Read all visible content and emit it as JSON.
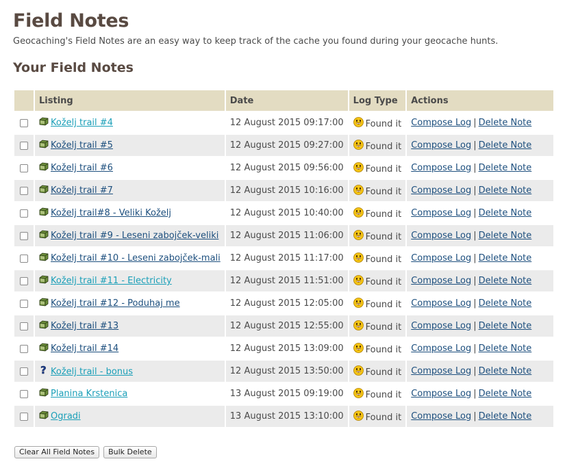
{
  "page": {
    "title": "Field Notes",
    "intro": "Geocaching's Field Notes are an easy way to keep track of the cache you found during your geocache hunts.",
    "subtitle": "Your Field Notes"
  },
  "table": {
    "headers": {
      "select": "",
      "listing": "Listing",
      "date": "Date",
      "log_type": "Log Type",
      "actions": "Actions"
    },
    "compose_label": "Compose Log",
    "delete_label": "Delete Note",
    "separator": "|",
    "rows": [
      {
        "listing": "Koželj trail #4",
        "date": "12 August 2015 09:17:00",
        "log_type": "Found it",
        "icon": "traditional-cache-icon",
        "visited": true
      },
      {
        "listing": "Koželj trail #5",
        "date": "12 August 2015 09:27:00",
        "log_type": "Found it",
        "icon": "traditional-cache-icon",
        "visited": false
      },
      {
        "listing": "Koželj trail #6",
        "date": "12 August 2015 09:56:00",
        "log_type": "Found it",
        "icon": "traditional-cache-icon",
        "visited": false
      },
      {
        "listing": "Koželj trail #7",
        "date": "12 August 2015 10:16:00",
        "log_type": "Found it",
        "icon": "traditional-cache-icon",
        "visited": false
      },
      {
        "listing": "Koželj trail#8 - Veliki Koželj",
        "date": "12 August 2015 10:40:00",
        "log_type": "Found it",
        "icon": "traditional-cache-icon",
        "visited": false
      },
      {
        "listing": "Koželj trail #9 - Leseni zabojček-veliki",
        "date": "12 August 2015 11:06:00",
        "log_type": "Found it",
        "icon": "traditional-cache-icon",
        "visited": false
      },
      {
        "listing": "Koželj trail #10 - Leseni zabojček-mali",
        "date": "12 August 2015 11:17:00",
        "log_type": "Found it",
        "icon": "traditional-cache-icon",
        "visited": false
      },
      {
        "listing": "Koželj trail #11 - Electricity",
        "date": "12 August 2015 11:51:00",
        "log_type": "Found it",
        "icon": "traditional-cache-icon",
        "visited": true
      },
      {
        "listing": "Koželj trail #12 - Poduhaj me",
        "date": "12 August 2015 12:05:00",
        "log_type": "Found it",
        "icon": "traditional-cache-icon",
        "visited": false
      },
      {
        "listing": "Koželj trail #13",
        "date": "12 August 2015 12:55:00",
        "log_type": "Found it",
        "icon": "traditional-cache-icon",
        "visited": false
      },
      {
        "listing": "Koželj trail #14",
        "date": "12 August 2015 13:09:00",
        "log_type": "Found it",
        "icon": "traditional-cache-icon",
        "visited": false
      },
      {
        "listing": "Koželj trail - bonus",
        "date": "12 August 2015 13:50:00",
        "log_type": "Found it",
        "icon": "mystery-cache-icon",
        "visited": true
      },
      {
        "listing": "Planina Krstenica",
        "date": "13 August 2015 09:19:00",
        "log_type": "Found it",
        "icon": "traditional-cache-icon",
        "visited": true
      },
      {
        "listing": "Ogradi",
        "date": "13 August 2015 13:10:00",
        "log_type": "Found it",
        "icon": "traditional-cache-icon",
        "visited": true
      }
    ]
  },
  "buttons": {
    "clear_all": "Clear All Field Notes",
    "bulk_delete": "Bulk Delete"
  },
  "colors": {
    "header_bg": "#e3dcc2",
    "row_alt_bg": "#ebebeb",
    "title": "#594a42",
    "link": "#1d4f7e",
    "link_visited": "#1a9fb8"
  }
}
